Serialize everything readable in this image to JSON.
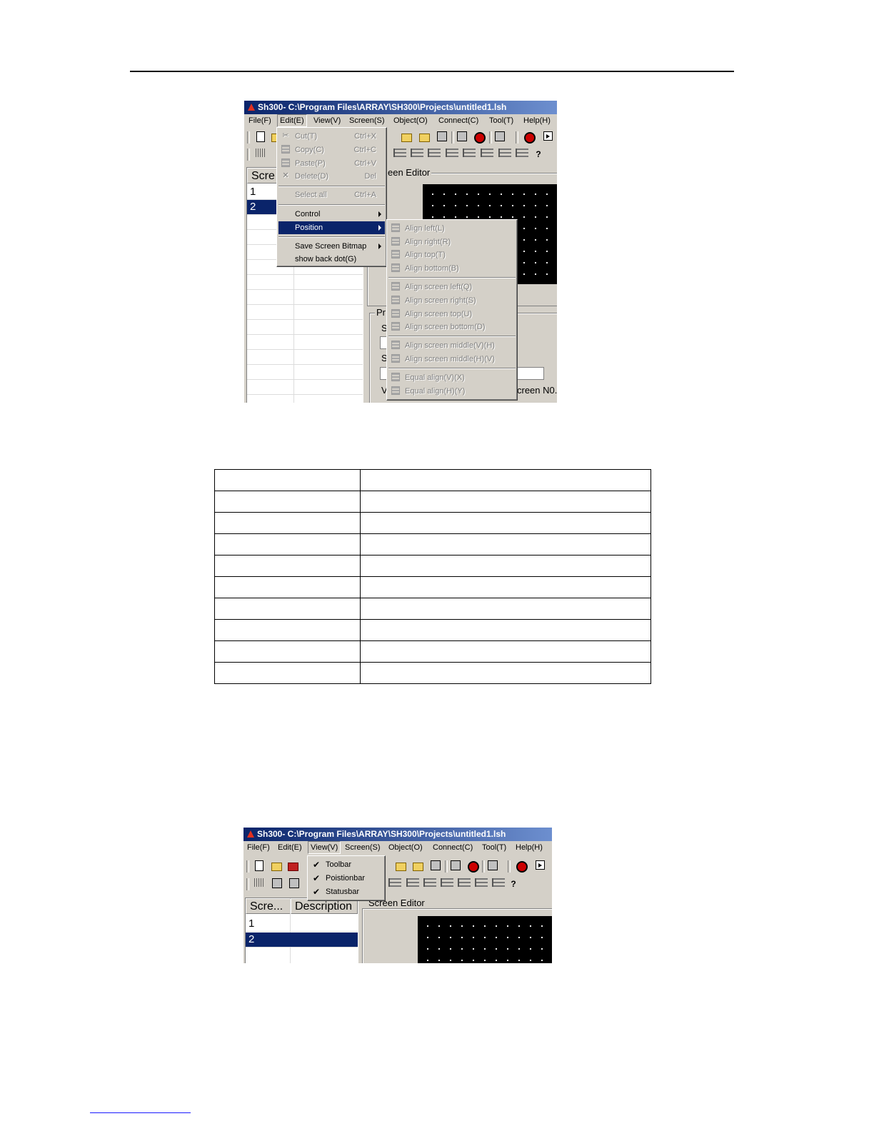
{
  "window1": {
    "title": "Sh300- C:\\Program Files\\ARRAY\\SH300\\Projects\\untitled1.lsh",
    "menus": [
      "File(F)",
      "Edit(E)",
      "View(V)",
      "Screen(S)",
      "Object(O)",
      "Connect(C)",
      "Tool(T)",
      "Help(H)"
    ],
    "list_header": "Scre",
    "rows": [
      "1",
      "2"
    ],
    "screen_editor_label": "een Editor",
    "props_label": "Pr",
    "props_fragments": [
      "S",
      "S",
      "V",
      "creen N0."
    ],
    "edit_menu": [
      {
        "label": "Cut(T)",
        "shortcut": "Ctrl+X"
      },
      {
        "label": "Copy(C)",
        "shortcut": "Ctrl+C"
      },
      {
        "label": "Paste(P)",
        "shortcut": "Ctrl+V"
      },
      {
        "label": "Delete(D)",
        "shortcut": "Del"
      },
      {
        "label": "Select all",
        "shortcut": "Ctrl+A"
      },
      {
        "label": "Control"
      },
      {
        "label": "Position"
      },
      {
        "label": "Save Screen Bitmap"
      },
      {
        "label": "show back dot(G)"
      }
    ],
    "position_menu": [
      "Align left(L)",
      "Align right(R)",
      "Align top(T)",
      "Align bottom(B)",
      "Align screen left(Q)",
      "Align screen right(S)",
      "Align screen top(U)",
      "Align screen bottom(D)",
      "Align screen middle(V)(H)",
      "Align screen middle(H)(V)",
      "Equal align(V)(X)",
      "Equal align(H)(Y)"
    ]
  },
  "window2": {
    "title": "Sh300- C:\\Program Files\\ARRAY\\SH300\\Projects\\untitled1.lsh",
    "menus": [
      "File(F)",
      "Edit(E)",
      "View(V)",
      "Screen(S)",
      "Object(O)",
      "Connect(C)",
      "Tool(T)",
      "Help(H)"
    ],
    "list_headers": [
      "Scre...",
      "Description"
    ],
    "rows": [
      "1",
      "2"
    ],
    "screen_editor_label": "Screen Editor",
    "view_menu": [
      "Toolbar",
      "Poistionbar",
      "Statusbar"
    ]
  }
}
